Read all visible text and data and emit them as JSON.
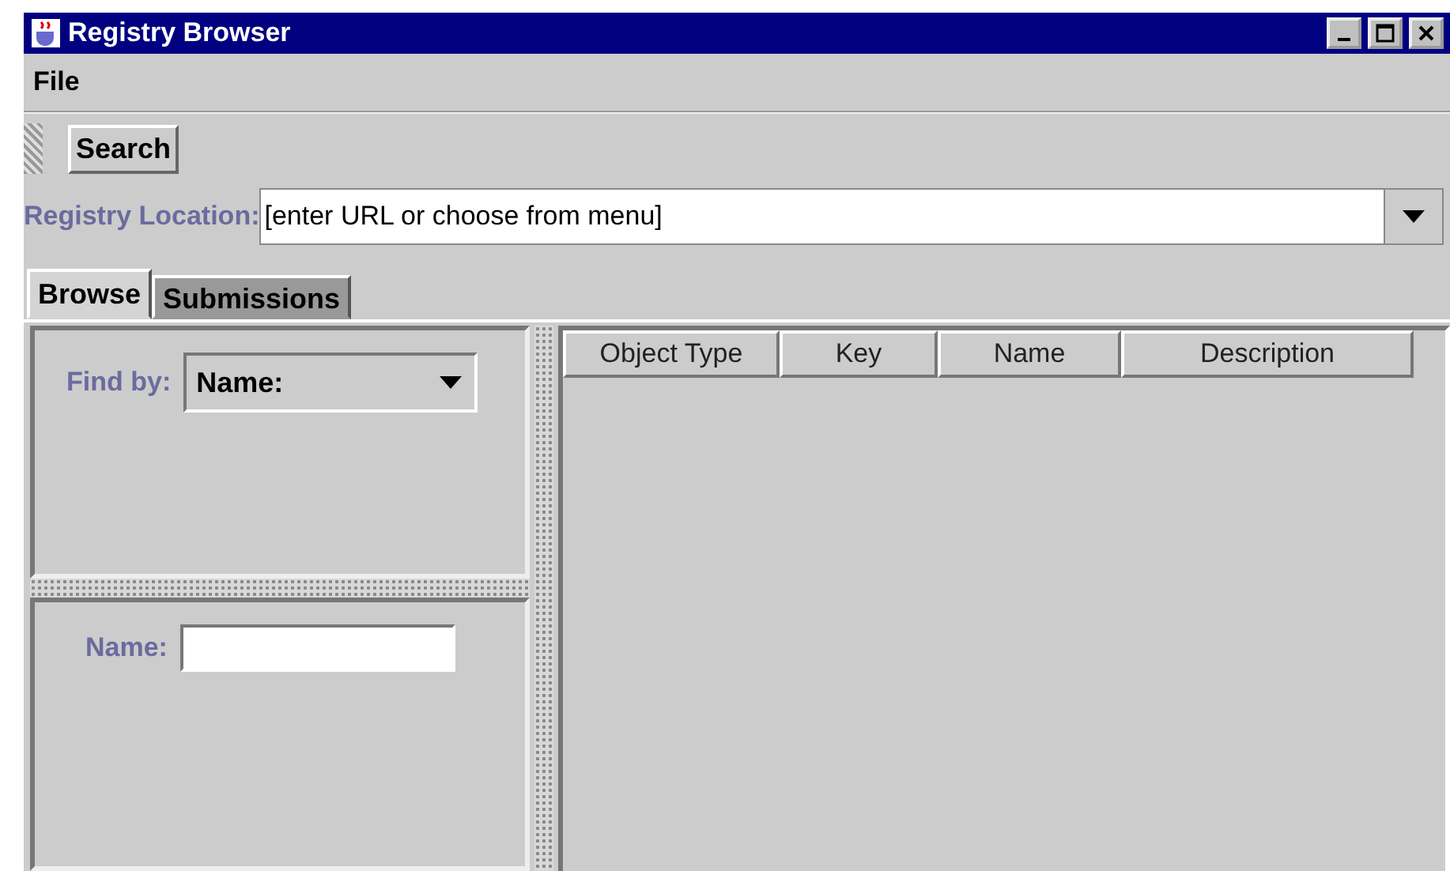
{
  "window": {
    "title": "Registry Browser"
  },
  "menu": [
    "File"
  ],
  "toolbar": {
    "buttons": [
      "Search"
    ]
  },
  "location": {
    "label": "Registry Location:",
    "value": "[enter URL or choose from menu]"
  },
  "tabs": [
    {
      "label": "Browse",
      "selected": true
    },
    {
      "label": "Submissions",
      "selected": false
    }
  ],
  "find_by": {
    "label": "Find by:",
    "value": "Name:"
  },
  "name_field": {
    "label": "Name:"
  },
  "table": {
    "columns": [
      "Object Type",
      "Key",
      "Name",
      "Description"
    ]
  }
}
